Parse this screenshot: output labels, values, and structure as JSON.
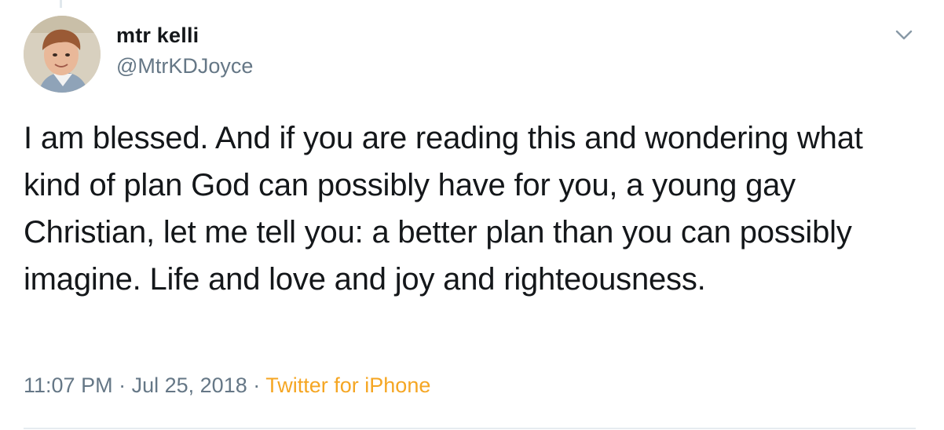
{
  "tweet": {
    "author": {
      "display_name": "mtr kelli",
      "handle": "@MtrKDJoyce"
    },
    "text": "I am blessed. And if you are reading this and wondering what kind of plan God can possibly have for you, a young gay Christian, let me tell you: a better plan than you can possibly imagine. Life and love and joy and righteousness.",
    "time": "11:07 PM",
    "separator": "·",
    "date": "Jul 25, 2018",
    "source": "Twitter for iPhone"
  },
  "icons": {
    "menu": "chevron-down-icon"
  },
  "colors": {
    "primary_text": "#14171a",
    "secondary_text": "#657786",
    "source_link": "#f5a623",
    "divider": "#e6ecf0"
  }
}
